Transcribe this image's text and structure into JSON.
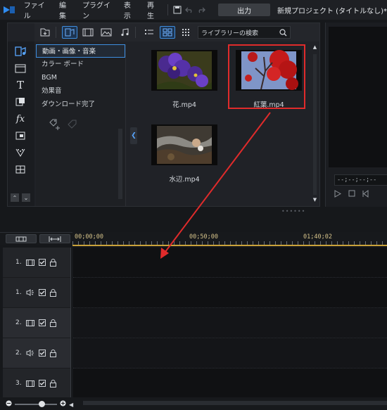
{
  "menu": {
    "items": [
      "ファイル",
      "編集",
      "プラグイン",
      "表示",
      "再生"
    ],
    "output_label": "出力",
    "project_title": "新規プロジェクト (タイトルなし)*"
  },
  "library": {
    "search_placeholder": "ライブラリーの検索",
    "categories": [
      {
        "label": "動画・画像・音楽",
        "selected": true
      },
      {
        "label": "カラー ボード",
        "selected": false
      },
      {
        "label": "BGM",
        "selected": false
      },
      {
        "label": "効果音",
        "selected": false
      },
      {
        "label": "ダウンロード完了",
        "selected": false
      }
    ],
    "media": [
      {
        "label": "花.mp4",
        "selected": false
      },
      {
        "label": "紅葉.mp4",
        "selected": true
      },
      {
        "label": "水辺.mp4",
        "selected": false
      }
    ]
  },
  "preview": {
    "timecode": "--;--;--;--"
  },
  "timeline": {
    "ruler_labels": [
      "00;00;00",
      "00;50;00",
      "01;40;02"
    ],
    "tracks": [
      {
        "label": "1.",
        "type": "video"
      },
      {
        "label": "1.",
        "type": "audio"
      },
      {
        "label": "2.",
        "type": "video"
      },
      {
        "label": "2.",
        "type": "audio"
      },
      {
        "label": "3.",
        "type": "video"
      }
    ]
  },
  "colors": {
    "accent": "#3e8ee0",
    "annotation": "#e02b2b",
    "ruler_highlight": "#c9a23a"
  }
}
